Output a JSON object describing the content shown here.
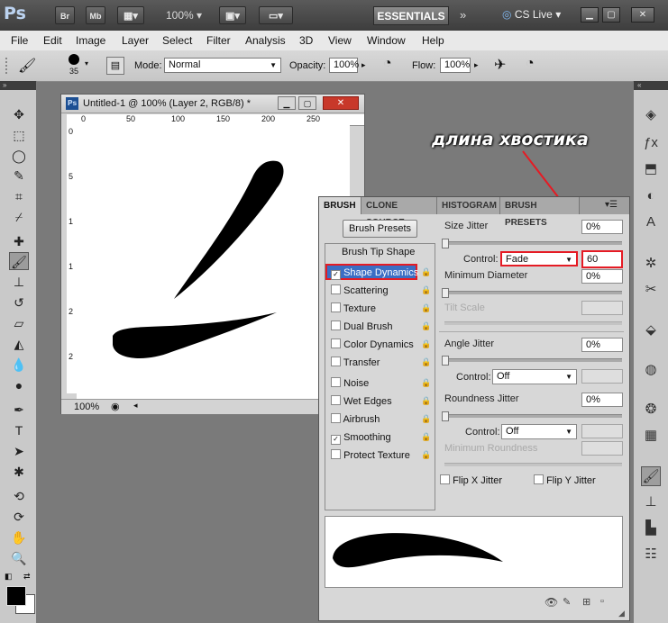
{
  "appbar": {
    "logo": "Ps",
    "br_label": "Br",
    "mb_label": "Mb",
    "zoom": "100%",
    "workspace_label": "ESSENTIALS",
    "cslive_label": "CS Live"
  },
  "menu": [
    "File",
    "Edit",
    "Image",
    "Layer",
    "Select",
    "Filter",
    "Analysis",
    "3D",
    "View",
    "Window",
    "Help"
  ],
  "options": {
    "brush_size": "35",
    "mode_label": "Mode:",
    "mode_value": "Normal",
    "opacity_label": "Opacity:",
    "opacity_value": "100%",
    "flow_label": "Flow:",
    "flow_value": "100%"
  },
  "document": {
    "title": "Untitled-1 @ 100% (Layer 2, RGB/8) *",
    "ruler_ticks": [
      "0",
      "50",
      "100",
      "150",
      "200",
      "250"
    ],
    "vruler_ticks": [
      "0",
      "5",
      "1",
      "1",
      "2",
      "2"
    ],
    "zoom": "100%"
  },
  "annotation": {
    "text": "длина хвостика",
    "color": "#e51b24"
  },
  "brush_panel": {
    "tabs": [
      "BRUSH",
      "CLONE SOURCE",
      "HISTOGRAM",
      "BRUSH PRESETS"
    ],
    "presets_button": "Brush Presets",
    "tip_shape": "Brush Tip Shape",
    "options": [
      {
        "label": "Shape Dynamics",
        "checked": true
      },
      {
        "label": "Scattering",
        "checked": false
      },
      {
        "label": "Texture",
        "checked": false
      },
      {
        "label": "Dual Brush",
        "checked": false
      },
      {
        "label": "Color Dynamics",
        "checked": false
      },
      {
        "label": "Transfer",
        "checked": false
      },
      {
        "label": "Noise",
        "checked": false
      },
      {
        "label": "Wet Edges",
        "checked": false
      },
      {
        "label": "Airbrush",
        "checked": false
      },
      {
        "label": "Smoothing",
        "checked": true
      },
      {
        "label": "Protect Texture",
        "checked": false
      }
    ],
    "size_jitter_label": "Size Jitter",
    "size_jitter_value": "0%",
    "control_label": "Control:",
    "control_value": "Fade",
    "fade_steps": "60",
    "min_diameter_label": "Minimum Diameter",
    "min_diameter_value": "0%",
    "tilt_scale_label": "Tilt Scale",
    "angle_jitter_label": "Angle Jitter",
    "angle_jitter_value": "0%",
    "angle_control_value": "Off",
    "roundness_jitter_label": "Roundness Jitter",
    "roundness_jitter_value": "0%",
    "roundness_control_value": "Off",
    "min_roundness_label": "Minimum Roundness",
    "flip_x_label": "Flip X Jitter",
    "flip_y_label": "Flip Y Jitter",
    "highlight_color": "#e51b24"
  }
}
